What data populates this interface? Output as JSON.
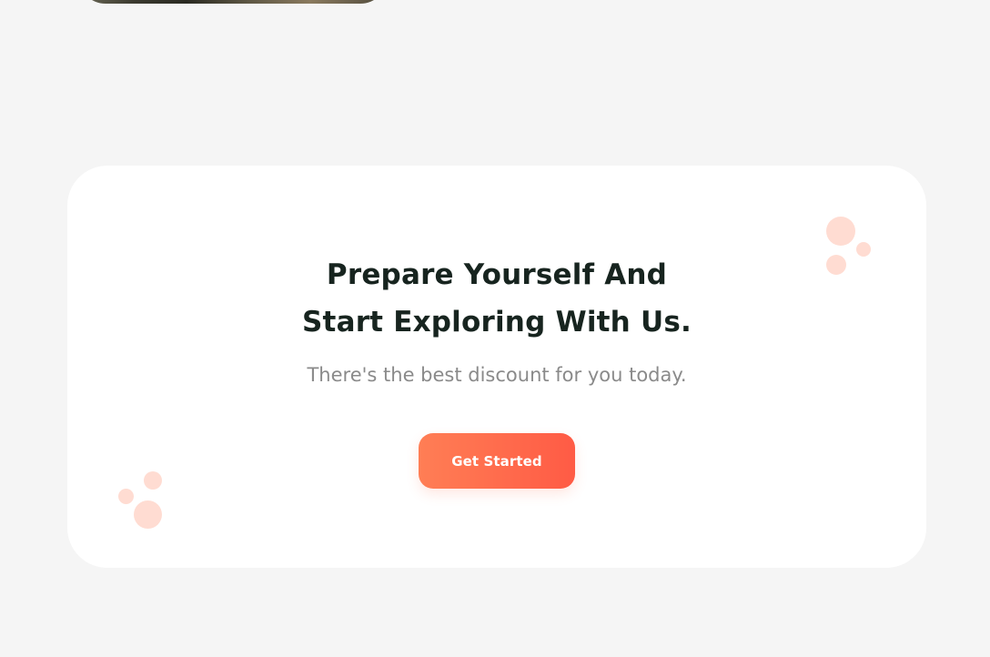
{
  "cta": {
    "title_line1": "Prepare Yourself And",
    "title_line2": "Start Exploring With Us.",
    "subtitle": "There's the best discount for you today.",
    "button_label": "Get Started"
  },
  "colors": {
    "background": "#f5f5f5",
    "card": "#ffffff",
    "title": "#17241f",
    "subtitle": "#8a8a8a",
    "accent_start": "#ff7e55",
    "accent_end": "#ff5b45",
    "dot": "#ffdcd2"
  }
}
